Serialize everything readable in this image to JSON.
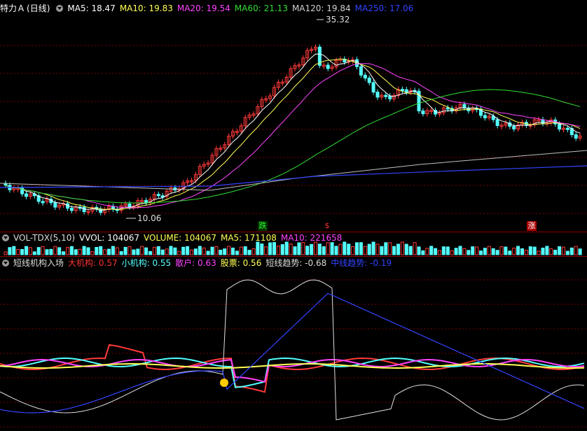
{
  "main_header": {
    "title": "特力Ａ",
    "period": "(日线)",
    "ma5": "MA5: 18.47",
    "ma10": "MA10: 19.83",
    "ma20": "MA20: 19.54",
    "ma60": "MA60: 21.13",
    "ma120": "MA120: 19.84",
    "ma250": "MA250: 17.06"
  },
  "price_labels": {
    "high": "35.32",
    "low": "10.06"
  },
  "markers": {
    "m1": "跌",
    "m2": "$",
    "m3": "涨"
  },
  "volume_header": {
    "name": "VOL-TDX(5,10)",
    "vvol": "VVOL: 104067",
    "volume": "VOLUME: 104067",
    "ma5": "MA5: 171108",
    "ma10": "MA10: 221658"
  },
  "indicator_header": {
    "name": "短线机构入场",
    "big": "大机构: 0.57",
    "small": "小机构: 0.55",
    "retail": "散户: 0.63",
    "stock": "股票: 0.56",
    "trend": "短线趋势: -0.68",
    "mid": "中线趋势: -0.19"
  },
  "colors": {
    "bg": "#000000",
    "up": "#ff3a3a",
    "down": "#54ffff",
    "ma5": "#ffffff",
    "ma10": "#ffff55",
    "ma20": "#ff44ff",
    "ma60": "#33dd33",
    "ma120": "#c0c0c0",
    "ma250": "#3344ff",
    "grid": "#7a0000"
  },
  "icons": {
    "collapse": "chevron-down-icon",
    "smiley": "smiley-icon"
  }
}
